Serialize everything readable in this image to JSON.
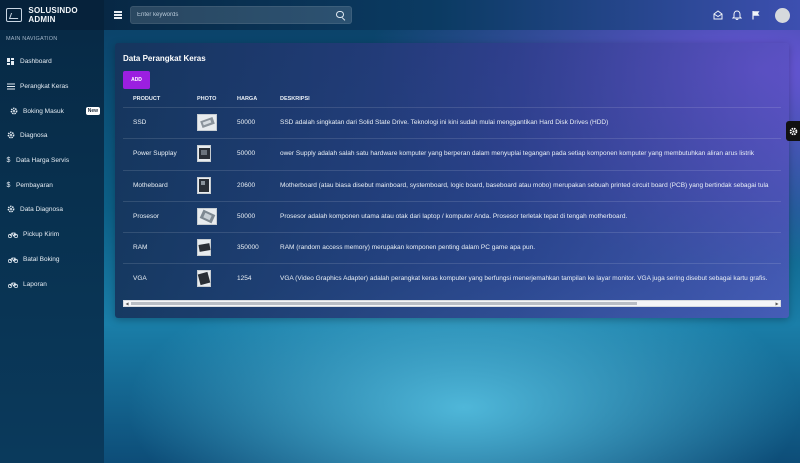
{
  "app": {
    "brand": "SOLUSINDO ADMIN"
  },
  "search": {
    "placeholder": "Enter keywords"
  },
  "sidebar": {
    "header": "MAIN NAVIGATION",
    "items": [
      {
        "label": "Dashboard",
        "icon": "dashboard-icon"
      },
      {
        "label": "Perangkat Keras",
        "icon": "list-icon"
      },
      {
        "label": "Boking Masuk",
        "icon": "gear-icon",
        "badge": "New"
      },
      {
        "label": "Diagnosa",
        "icon": "gear-icon"
      },
      {
        "label": "Data Harga Servis",
        "icon": "dollar-icon"
      },
      {
        "label": "Pembayaran",
        "icon": "dollar-icon"
      },
      {
        "label": "Data Diagnosa",
        "icon": "gear-icon"
      },
      {
        "label": "Pickup Kirim",
        "icon": "bicycle-icon"
      },
      {
        "label": "Batal Boking",
        "icon": "bicycle-icon"
      },
      {
        "label": "Laporan",
        "icon": "bicycle-icon"
      }
    ]
  },
  "panel": {
    "title": "Data Perangkat Keras",
    "add_label": "ADD",
    "columns": [
      "PRODUCT",
      "PHOTO",
      "HARGA",
      "DESKRIPSI"
    ],
    "rows": [
      {
        "product": "SSD",
        "harga": "50000",
        "deskripsi": "SSD adalah singkatan dari Solid State Drive. Teknologi ini kini sudah mulai menggantikan Hard Disk Drives (HDD)"
      },
      {
        "product": "Power Supplay",
        "harga": "50000",
        "deskripsi": "ower Supply adalah salah satu hardware komputer yang berperan dalam menyuplai tegangan pada setiap komponen komputer yang membutuhkan aliran arus listrik"
      },
      {
        "product": "Motheboard",
        "harga": "20600",
        "deskripsi": "Motherboard (atau biasa disebut mainboard, systemboard, logic board, baseboard atau mobo) merupakan sebuah printed circuit board (PCB) yang bertindak sebagai tula"
      },
      {
        "product": "Prosesor",
        "harga": "50000",
        "deskripsi": "Prosesor adalah komponen utama atau otak dari laptop / komputer Anda. Prosesor terletak tepat di tengah motherboard."
      },
      {
        "product": "RAM",
        "harga": "350000",
        "deskripsi": "RAM (random access memory) merupakan komponen penting dalam PC game apa pun."
      },
      {
        "product": "VGA",
        "harga": "1254",
        "deskripsi": "VGA (Video Graphics Adapter) adalah perangkat keras komputer yang berfungsi menerjemahkan tampilan ke layar monitor. VGA juga sering disebut sebagai kartu grafis."
      }
    ]
  }
}
